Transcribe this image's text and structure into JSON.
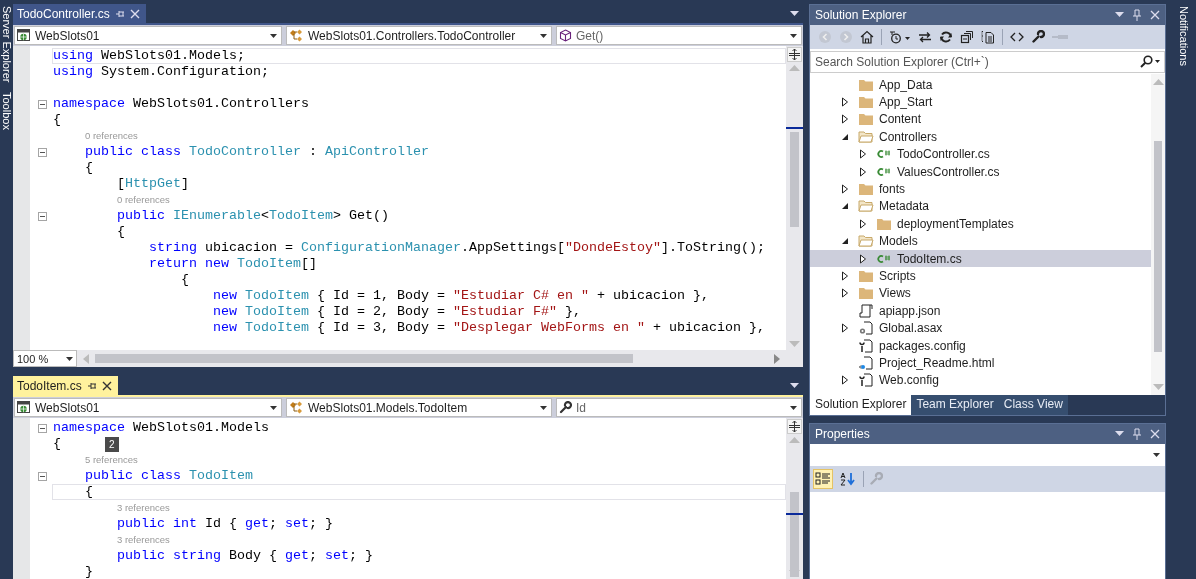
{
  "side_strip": {
    "tabs": [
      {
        "label": "Server Explorer"
      },
      {
        "label": "Toolbox"
      }
    ]
  },
  "editors": [
    {
      "tab": {
        "title": "TodoController.cs",
        "focused": false
      },
      "nav": [
        {
          "kind": "project",
          "text": "WebSlots01"
        },
        {
          "kind": "class",
          "text": "WebSlots01.Controllers.TodoController"
        },
        {
          "kind": "method",
          "text": "Get()"
        }
      ],
      "zoom": "100 %",
      "lines": [
        {
          "fold": false,
          "current": true,
          "tokens": [
            {
              "kind": "kw",
              "text": "using "
            },
            {
              "kind": "pl",
              "text": "WebSlots01.Models;"
            }
          ]
        },
        {
          "fold": false,
          "current": false,
          "tokens": [
            {
              "kind": "kw",
              "text": "using "
            },
            {
              "kind": "pl",
              "text": "System.Configuration;"
            }
          ]
        },
        {
          "fold": false,
          "current": false
        },
        {
          "fold": true,
          "current": false,
          "tokens": [
            {
              "kind": "kw",
              "text": "namespace "
            },
            {
              "kind": "pl",
              "text": "WebSlots01.Controllers"
            }
          ]
        },
        {
          "fold": false,
          "current": false,
          "tokens": [
            {
              "kind": "pl",
              "text": "{"
            }
          ]
        },
        {
          "fold": false,
          "current": false,
          "tokens": [
            {
              "kind": "lens",
              "text": "    0 references"
            }
          ]
        },
        {
          "fold": true,
          "current": false,
          "tokens": [
            {
              "kind": "kw",
              "text": "    public class "
            },
            {
              "kind": "ty",
              "text": "TodoController "
            },
            {
              "kind": "pl",
              "text": ": "
            },
            {
              "kind": "ty",
              "text": "ApiController"
            }
          ]
        },
        {
          "fold": false,
          "current": false,
          "tokens": [
            {
              "kind": "pl",
              "text": "    {"
            }
          ]
        },
        {
          "fold": false,
          "current": false,
          "tokens": [
            {
              "kind": "pl",
              "text": "        ["
            },
            {
              "kind": "ty",
              "text": "HttpGet"
            },
            {
              "kind": "pl",
              "text": "]"
            }
          ]
        },
        {
          "fold": false,
          "current": false,
          "tokens": [
            {
              "kind": "lens",
              "text": "        0 references"
            }
          ]
        },
        {
          "fold": true,
          "current": false,
          "tokens": [
            {
              "kind": "kw",
              "text": "        public "
            },
            {
              "kind": "ty",
              "text": "IEnumerable"
            },
            {
              "kind": "pl",
              "text": "<"
            },
            {
              "kind": "ty",
              "text": "TodoItem"
            },
            {
              "kind": "pl",
              "text": "> Get()"
            }
          ]
        },
        {
          "fold": false,
          "current": false,
          "tokens": [
            {
              "kind": "pl",
              "text": "        {"
            }
          ]
        },
        {
          "fold": false,
          "current": false,
          "tokens": [
            {
              "kind": "kw",
              "text": "            string "
            },
            {
              "kind": "pl",
              "text": "ubicacion = "
            },
            {
              "kind": "ty",
              "text": "ConfigurationManager"
            },
            {
              "kind": "pl",
              "text": ".AppSettings["
            },
            {
              "kind": "st",
              "text": "\"DondeEstoy\""
            },
            {
              "kind": "pl",
              "text": "].ToString();"
            }
          ]
        },
        {
          "fold": false,
          "current": false,
          "tokens": [
            {
              "kind": "kw",
              "text": "            return new "
            },
            {
              "kind": "ty",
              "text": "TodoItem"
            },
            {
              "kind": "pl",
              "text": "[]"
            }
          ]
        },
        {
          "fold": false,
          "current": false,
          "tokens": [
            {
              "kind": "pl",
              "text": "                {"
            }
          ]
        },
        {
          "fold": false,
          "current": false,
          "tokens": [
            {
              "kind": "kw",
              "text": "                    new "
            },
            {
              "kind": "ty",
              "text": "TodoItem "
            },
            {
              "kind": "pl",
              "text": "{ Id = 1, Body = "
            },
            {
              "kind": "st",
              "text": "\"Estudiar C# en \""
            },
            {
              "kind": "pl",
              "text": " + ubicacion },"
            }
          ]
        },
        {
          "fold": false,
          "current": false,
          "tokens": [
            {
              "kind": "kw",
              "text": "                    new "
            },
            {
              "kind": "ty",
              "text": "TodoItem "
            },
            {
              "kind": "pl",
              "text": "{ Id = 2, Body = "
            },
            {
              "kind": "st",
              "text": "\"Estudiar F#\""
            },
            {
              "kind": "pl",
              "text": " },"
            }
          ]
        },
        {
          "fold": false,
          "current": false,
          "tokens": [
            {
              "kind": "kw",
              "text": "                    new "
            },
            {
              "kind": "ty",
              "text": "TodoItem "
            },
            {
              "kind": "pl",
              "text": "{ Id = 3, Body = "
            },
            {
              "kind": "st",
              "text": "\"Desplegar WebForms en \""
            },
            {
              "kind": "pl",
              "text": " + ubicacion },"
            }
          ]
        }
      ]
    },
    {
      "tab": {
        "title": "TodoItem.cs",
        "focused": true
      },
      "nav": [
        {
          "kind": "project",
          "text": "WebSlots01"
        },
        {
          "kind": "class",
          "text": "WebSlots01.Models.TodoItem"
        },
        {
          "kind": "property",
          "text": "Id"
        }
      ],
      "lines": [
        {
          "fold": true,
          "current": false,
          "tokens": [
            {
              "kind": "kw",
              "text": "namespace "
            },
            {
              "kind": "pl",
              "text": "WebSlots01.Models"
            }
          ]
        },
        {
          "fold": false,
          "current": false,
          "badge": "2",
          "tokens": [
            {
              "kind": "pl",
              "text": "{"
            }
          ]
        },
        {
          "fold": false,
          "current": false,
          "tokens": [
            {
              "kind": "lens",
              "text": "    5 references"
            }
          ]
        },
        {
          "fold": true,
          "current": false,
          "tokens": [
            {
              "kind": "kw",
              "text": "    public class "
            },
            {
              "kind": "ty",
              "text": "TodoItem"
            }
          ]
        },
        {
          "fold": false,
          "current": true,
          "tokens": [
            {
              "kind": "pl",
              "text": "    {"
            }
          ]
        },
        {
          "fold": false,
          "current": false,
          "tokens": [
            {
              "kind": "lens",
              "text": "        3 references"
            }
          ]
        },
        {
          "fold": false,
          "current": false,
          "tokens": [
            {
              "kind": "kw",
              "text": "        public int "
            },
            {
              "kind": "pl",
              "text": "Id { "
            },
            {
              "kind": "kw",
              "text": "get"
            },
            {
              "kind": "pl",
              "text": "; "
            },
            {
              "kind": "kw",
              "text": "set"
            },
            {
              "kind": "pl",
              "text": "; }"
            }
          ]
        },
        {
          "fold": false,
          "current": false,
          "tokens": [
            {
              "kind": "lens",
              "text": "        3 references"
            }
          ]
        },
        {
          "fold": false,
          "current": false,
          "tokens": [
            {
              "kind": "kw",
              "text": "        public string "
            },
            {
              "kind": "pl",
              "text": "Body { "
            },
            {
              "kind": "kw",
              "text": "get"
            },
            {
              "kind": "pl",
              "text": "; "
            },
            {
              "kind": "kw",
              "text": "set"
            },
            {
              "kind": "pl",
              "text": "; }"
            }
          ]
        },
        {
          "fold": false,
          "current": false,
          "tokens": [
            {
              "kind": "pl",
              "text": "    }"
            }
          ]
        }
      ]
    }
  ],
  "solution_explorer": {
    "title": "Solution Explorer",
    "search": {
      "placeholder": "Search Solution Explorer (Ctrl+`)"
    },
    "tree": [
      {
        "label": "App_Data",
        "kind": "folder",
        "selected": false
      },
      {
        "label": "App_Start",
        "kind": "folder",
        "expanded": false,
        "selected": false
      },
      {
        "label": "Content",
        "kind": "folder",
        "expanded": false,
        "selected": false
      },
      {
        "label": "Controllers",
        "kind": "folder",
        "expanded": true,
        "selected": false,
        "children": [
          {
            "label": "TodoController.cs",
            "kind": "cs",
            "expanded": false,
            "selected": false
          },
          {
            "label": "ValuesController.cs",
            "kind": "cs",
            "expanded": false,
            "selected": false
          }
        ]
      },
      {
        "label": "fonts",
        "kind": "folder",
        "expanded": false,
        "selected": false
      },
      {
        "label": "Metadata",
        "kind": "folder",
        "expanded": true,
        "selected": false,
        "children": [
          {
            "label": "deploymentTemplates",
            "kind": "folder",
            "expanded": false,
            "selected": false
          }
        ]
      },
      {
        "label": "Models",
        "kind": "folder",
        "expanded": true,
        "selected": false,
        "children": [
          {
            "label": "TodoItem.cs",
            "kind": "cs",
            "expanded": false,
            "selected": true
          }
        ]
      },
      {
        "label": "Scripts",
        "kind": "folder",
        "expanded": false,
        "selected": false
      },
      {
        "label": "Views",
        "kind": "folder",
        "expanded": false,
        "selected": false
      },
      {
        "label": "apiapp.json",
        "kind": "json",
        "selected": false
      },
      {
        "label": "Global.asax",
        "kind": "asax",
        "expanded": false,
        "selected": false
      },
      {
        "label": "packages.config",
        "kind": "config",
        "selected": false
      },
      {
        "label": "Project_Readme.html",
        "kind": "html",
        "selected": false
      },
      {
        "label": "Web.config",
        "kind": "config",
        "expanded": false,
        "selected": false
      }
    ],
    "tabs": [
      {
        "label": "Solution Explorer",
        "selected": true
      },
      {
        "label": "Team Explorer",
        "selected": false
      },
      {
        "label": "Class View",
        "selected": false
      }
    ]
  },
  "notifications": {
    "label": "Notifications"
  },
  "properties": {
    "title": "Properties",
    "view_buttons": [
      {
        "kind": "categorized",
        "selected": true
      },
      {
        "kind": "alphabetical",
        "selected": false
      }
    ]
  }
}
